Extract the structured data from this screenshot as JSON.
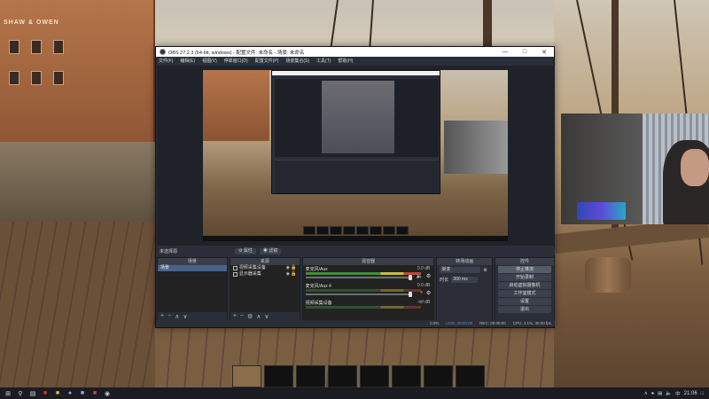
{
  "game": {
    "building_sign": "SHAW & OWEN"
  },
  "obs": {
    "window_title": "OBS 27.2.3 (64-bit, windows) - 配置文件: 未命名 - 场景: 未命名",
    "menu": [
      "文件(F)",
      "编辑(E)",
      "视图(V)",
      "停靠窗口(D)",
      "配置文件(P)",
      "场景集合(S)",
      "工具(T)",
      "帮助(H)"
    ],
    "scene_selector": {
      "label": "未选择源",
      "properties_button": "属性",
      "filters_button": "滤镜"
    },
    "docks": {
      "scenes": {
        "title": "场景",
        "items": [
          "场景"
        ]
      },
      "sources": {
        "title": "来源",
        "items": [
          "视频采集设备",
          "显示器采集"
        ]
      },
      "mixer": {
        "title": "混音器",
        "channels": [
          {
            "name": "麦克风/Aux",
            "db": "0.0 dB"
          },
          {
            "name": "麦克风/Aux 4",
            "db": "0.0 dB"
          },
          {
            "name": "视频采集设备",
            "db": "-inf dB"
          }
        ]
      },
      "transitions": {
        "title": "转场动画",
        "type": "渐变",
        "duration_label": "时长",
        "duration_value": "300 ms"
      },
      "controls": {
        "title": "控件",
        "buttons": [
          "停止推流",
          "开始录制",
          "启动虚拟摄像机",
          "工作室模式",
          "设置",
          "退出"
        ]
      }
    },
    "statusbar": {
      "dropped": "0.0%",
      "live": "LIVE: 00:00:00",
      "rec": "REC: 00:00:00",
      "cpu": "CPU: 3.1%, 30.00 fps"
    }
  },
  "taskbar": {
    "clock": "21:06",
    "tray_lang": "中"
  }
}
